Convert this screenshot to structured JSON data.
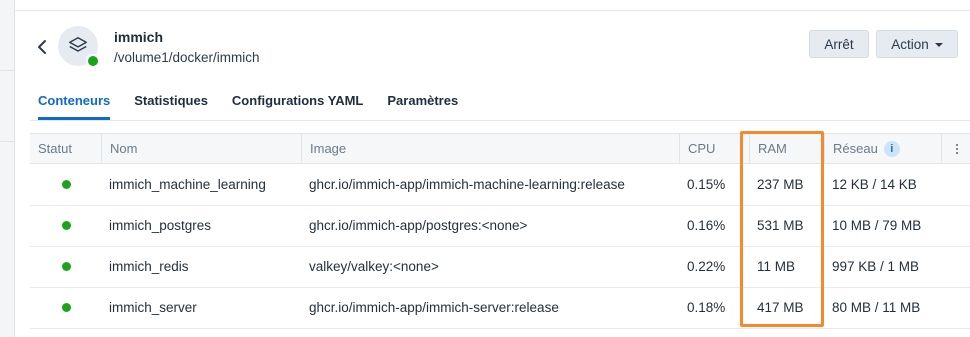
{
  "app": {
    "title": "immich",
    "path": "/volume1/docker/immich",
    "status_color": "#1ba31b"
  },
  "buttons": {
    "stop_label": "Arrêt",
    "action_label": "Action"
  },
  "tabs": [
    {
      "label": "Conteneurs",
      "active": true
    },
    {
      "label": "Statistiques",
      "active": false
    },
    {
      "label": "Configurations YAML",
      "active": false
    },
    {
      "label": "Paramètres",
      "active": false
    }
  ],
  "table": {
    "columns": [
      "Statut",
      "Nom",
      "Image",
      "CPU",
      "RAM",
      "Réseau"
    ],
    "network_info_icon": "i",
    "rows": [
      {
        "status": "running",
        "name": "immich_machine_learning",
        "image": "ghcr.io/immich-app/immich-machine-learning:release",
        "cpu": "0.15%",
        "ram": "237 MB",
        "network": "12 KB / 14 KB"
      },
      {
        "status": "running",
        "name": "immich_postgres",
        "image": "ghcr.io/immich-app/postgres:<none>",
        "cpu": "0.16%",
        "ram": "531 MB",
        "network": "10 MB / 79 MB"
      },
      {
        "status": "running",
        "name": "immich_redis",
        "image": "valkey/valkey:<none>",
        "cpu": "0.22%",
        "ram": "11 MB",
        "network": "997 KB / 1 MB"
      },
      {
        "status": "running",
        "name": "immich_server",
        "image": "ghcr.io/immich-app/immich-server:release",
        "cpu": "0.18%",
        "ram": "417 MB",
        "network": "80 MB / 11 MB"
      }
    ]
  },
  "colors": {
    "accent": "#0d6bc9",
    "status_running": "#1ba31b",
    "highlight": "#f58a2c"
  }
}
